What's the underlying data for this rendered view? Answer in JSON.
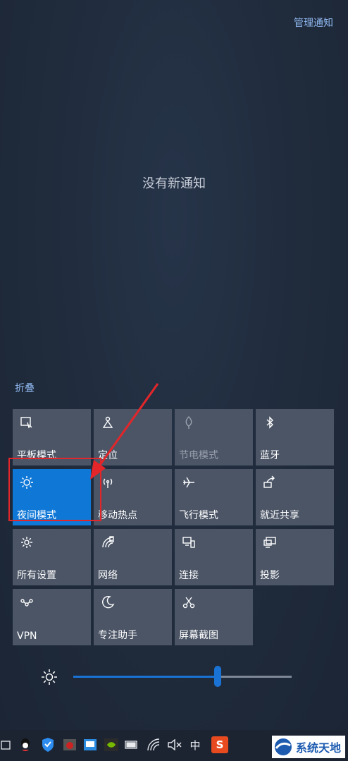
{
  "header": {
    "manage_label": "管理通知"
  },
  "notifications": {
    "empty_text": "没有新通知"
  },
  "collapse_label": "折叠",
  "quick_actions": [
    {
      "label": "平板模式",
      "icon": "tablet-mode-icon",
      "state": "off"
    },
    {
      "label": "定位",
      "icon": "location-icon",
      "state": "off"
    },
    {
      "label": "节电模式",
      "icon": "battery-saver-icon",
      "state": "disabled"
    },
    {
      "label": "蓝牙",
      "icon": "bluetooth-icon",
      "state": "off"
    },
    {
      "label": "夜间模式",
      "icon": "night-light-icon",
      "state": "on"
    },
    {
      "label": "移动热点",
      "icon": "mobile-hotspot-icon",
      "state": "off"
    },
    {
      "label": "飞行模式",
      "icon": "airplane-icon",
      "state": "off"
    },
    {
      "label": "就近共享",
      "icon": "nearby-share-icon",
      "state": "off"
    },
    {
      "label": "所有设置",
      "icon": "gear-icon",
      "state": "off"
    },
    {
      "label": "网络",
      "icon": "network-icon",
      "state": "off"
    },
    {
      "label": "连接",
      "icon": "connect-icon",
      "state": "off"
    },
    {
      "label": "投影",
      "icon": "project-icon",
      "state": "off"
    },
    {
      "label": "VPN",
      "icon": "vpn-icon",
      "state": "off"
    },
    {
      "label": "专注助手",
      "icon": "focus-assist-icon",
      "state": "off"
    },
    {
      "label": "屏幕截图",
      "icon": "screen-snip-icon",
      "state": "off"
    }
  ],
  "brightness": {
    "level_fraction": 0.66,
    "accent": "#1a73d4"
  },
  "taskbar": {
    "ime_label": "中",
    "sogou_label": "S"
  },
  "watermark": {
    "text": "系统天地"
  },
  "colors": {
    "active_tile": "#0f78d7",
    "tile": "#4b5566",
    "link": "#8fb7ef",
    "annotation": "#e2262a"
  }
}
